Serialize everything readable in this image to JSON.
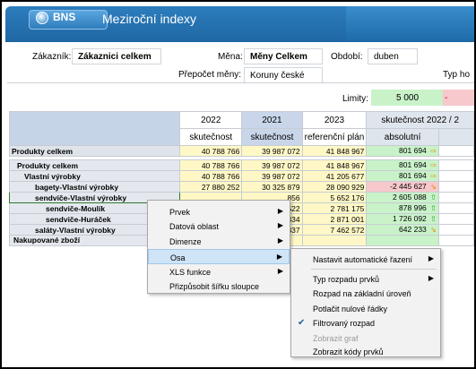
{
  "app": {
    "logo": "BNS",
    "title": "Meziroční indexy"
  },
  "filters": {
    "customer_label": "Zákazník:",
    "customer_value": "Zákaznici celkem",
    "currency_label": "Měna:",
    "currency_value": "Měny Celkem",
    "period_label": "Období:",
    "period_value": "duben",
    "conversion_label": "Přepočet měny:",
    "conversion_value": "Koruny české",
    "type_label": "Typ ho"
  },
  "limits": {
    "label": "Limity:",
    "green": "5 000",
    "red": "-"
  },
  "grid": {
    "years": [
      "2022",
      "2021",
      "2023"
    ],
    "abs_group": "skutečnost 2022 / 2",
    "subheaders": [
      "skutečnost",
      "skutečnost",
      "referenční plán",
      "absolutní"
    ],
    "rows": [
      {
        "label": "Produkty celkem",
        "v1": "40 788 766",
        "v2": "39 987 072",
        "v3": "41 848 967",
        "abs": "801 694",
        "icon": "⇨"
      },
      {
        "label": "Produkty celkem",
        "v1": "40 788 766",
        "v2": "39 987 072",
        "v3": "41 848 967",
        "abs": "801 694",
        "icon": "⇨"
      },
      {
        "label": "Vlastní výrobky",
        "v1": "40 788 766",
        "v2": "39 987 072",
        "v3": "41 205 677",
        "abs": "801 694",
        "icon": "⇨"
      },
      {
        "label": "bagety-Vlastní výrobky",
        "v1": "27 880 252",
        "v2": "30 325 879",
        "v3": "28 090 929",
        "abs": "-2 445 627",
        "icon": "⇘"
      },
      {
        "label": "sendviče-Vlastní výrobky",
        "v1": "",
        "v2": "856",
        "v3": "5 652 176",
        "abs": "2 605 088",
        "icon": "⇧"
      },
      {
        "label": "sendviče-Moulík",
        "v1": "",
        "v2": "522",
        "v3": "2 781 175",
        "abs": "878 996",
        "icon": "⇧"
      },
      {
        "label": "sendviče-Huráček",
        "v1": "",
        "v2": "334",
        "v3": "2 871 001",
        "abs": "1 726 092",
        "icon": "⇧"
      },
      {
        "label": "saláty-Vlastní výrobky",
        "v1": "",
        "v2": "337",
        "v3": "7 462 572",
        "abs": "642 233",
        "icon": "⇘"
      },
      {
        "label": "Nakupované zboží",
        "v1": "",
        "v2": "",
        "v3": "",
        "abs": "",
        "icon": ""
      }
    ]
  },
  "context_menu": {
    "items": [
      {
        "label": "Prvek",
        "submenu": true
      },
      {
        "label": "Datová oblast",
        "submenu": true
      },
      {
        "label": "Dimenze",
        "submenu": true
      },
      {
        "label": "Osa",
        "submenu": true,
        "active": true
      },
      {
        "label": "XLS funkce",
        "submenu": true
      },
      {
        "label": "Přizpůsobit šířku sloupce",
        "submenu": false
      }
    ]
  },
  "submenu": {
    "items": [
      {
        "label": "Nastavit automatické řazení",
        "submenu": true
      },
      {
        "label": "Typ rozpadu prvků",
        "submenu": true
      },
      {
        "label": "Rozpad na základní úroveň"
      },
      {
        "label": "Potlačit nulové řádky"
      },
      {
        "label": "Filtrovaný rozpad",
        "checked": true
      },
      {
        "label": "Zobrazit graf",
        "disabled": true
      },
      {
        "label": "Zobrazit kódy prvků"
      }
    ]
  },
  "colors": {
    "header_blue": "#1f67a4",
    "positive": "#c9f2c9",
    "negative": "#f7c8cc",
    "highlight_yellow": "#fff8c6"
  }
}
